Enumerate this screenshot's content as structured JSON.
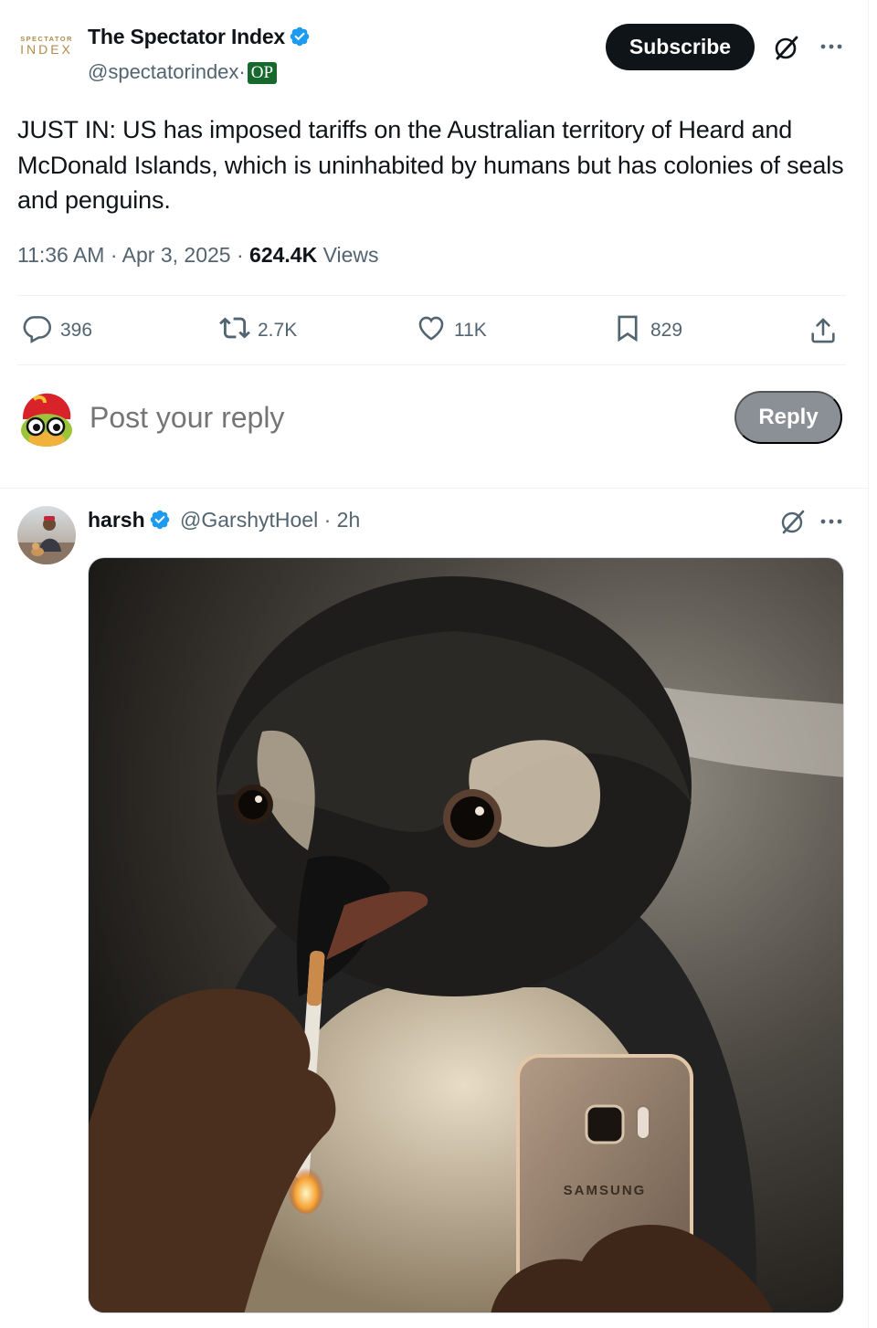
{
  "tweet": {
    "author": {
      "logo_small": "SPECTATOR",
      "logo_big": "INDEX",
      "name": "The Spectator Index",
      "handle": "@spectatorindex",
      "separator": "·",
      "op_badge": "OP"
    },
    "subscribe_label": "Subscribe",
    "text": "JUST IN: US has imposed tariffs on the Australian territory of Heard and McDonald Islands, which is uninhabited by humans but has colonies of seals and penguins.",
    "time": "11:36 AM",
    "date": "Apr 3, 2025",
    "dot": "·",
    "views_count": "624.4K",
    "views_label": "Views",
    "stats": {
      "replies": "396",
      "reposts": "2.7K",
      "likes": "11K",
      "bookmarks": "829"
    }
  },
  "composer": {
    "placeholder": "Post your reply",
    "reply_label": "Reply"
  },
  "reply": {
    "name": "harsh",
    "handle": "@GarshytHoel",
    "time": "2h",
    "media_phone_brand": "SAMSUNG"
  },
  "colors": {
    "text_primary": "#0f1419",
    "text_secondary": "#536471",
    "verified": "#1d9bf0",
    "op_badge": "#17682c",
    "logo": "#b08c4c"
  },
  "icons": {
    "verified": "verified-badge-icon",
    "grok": "grok-icon",
    "more": "more-dots-icon",
    "reply": "reply-bubble-icon",
    "repost": "repost-icon",
    "like": "heart-icon",
    "bookmark": "bookmark-icon",
    "share": "share-icon"
  }
}
